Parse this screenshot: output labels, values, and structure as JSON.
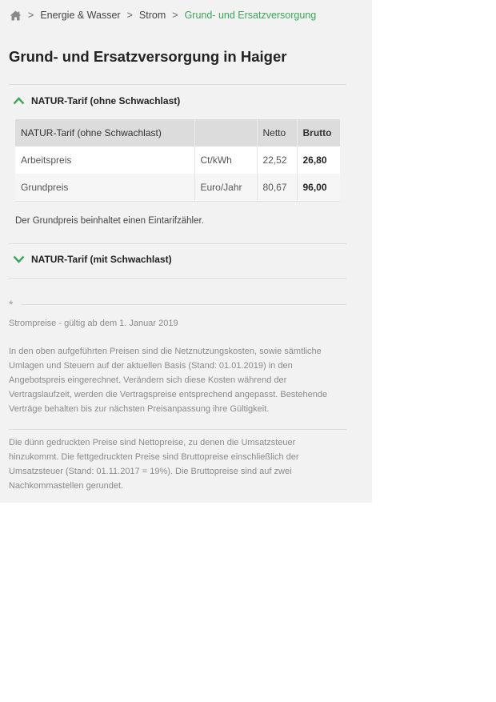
{
  "breadcrumb": {
    "home_icon": "home-icon",
    "items": [
      "Energie & Wasser",
      "Strom",
      "Grund- und Ersatzversorgung"
    ],
    "separator": ">"
  },
  "page_title": "Grund- und Ersatzversorgung in Haiger",
  "accordion": [
    {
      "title": "NATUR-Tarif (ohne Schwachlast)",
      "expanded": true,
      "icon": "chevron-up-icon",
      "table": {
        "headers": [
          "NATUR-Tarif (ohne Schwachlast)",
          "",
          "Netto",
          "Brutto"
        ],
        "rows": [
          [
            "Arbeitspreis",
            "Ct/kWh",
            "22,52",
            "26,80"
          ],
          [
            "Grundpreis",
            "Euro/Jahr",
            "80,67",
            "96,00"
          ]
        ]
      },
      "note": "Der Grundpreis beinhaltet einen Eintarifzähler."
    },
    {
      "title": "NATUR-Tarif (mit Schwachlast)",
      "expanded": false,
      "icon": "chevron-down-icon"
    }
  ],
  "footnote": {
    "star": "*",
    "validity": "Strompreise - gültig ab dem 1. Januar 2019",
    "paragraph1": "In den oben aufgeführten Preisen sind die Netznutzungskosten, sowie sämtliche Umlagen und Steuern auf der aktuellen Basis (Stand: 01.01.2019) in den Angebotspreis eingerechnet. Verändern sich diese Kosten während der Vertragslaufzeit, werden die Vertragspreise entsprechend angepasst. Bestehende Verträge behalten bis zur nächsten Preisanpassung ihre Gültigkeit.",
    "paragraph2": "Die dünn gedruckten Preise sind Nettopreise, zu denen die Umsatzsteuer hinzukommt. Die fettgedruckten Preise sind Bruttopreise einschließlich der Umsatzsteuer (Stand: 01.11.2017 = 19%). Die Bruttopreise sind auf zwei Nachkommastellen gerundet."
  },
  "colors": {
    "accent": "#3aa55a",
    "background": "#f2f2f2"
  }
}
